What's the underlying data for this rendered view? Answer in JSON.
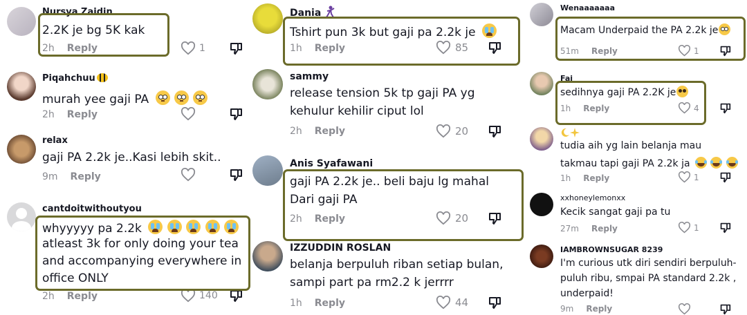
{
  "columns": [
    {
      "comments": [
        {
          "username": "Nursya Zaidin",
          "text": [
            "2.2K je bg 5K kak"
          ],
          "time": "2h",
          "reply": "Reply",
          "likes": "1",
          "highlighted": true
        },
        {
          "username": "Piqahchuu",
          "text": [
            "murah yee gaji PA"
          ],
          "time": "2h",
          "reply": "Reply",
          "likes": "",
          "highlighted": false
        },
        {
          "username": "relax",
          "text": [
            "gaji PA 2.2k je..Kasi lebih skit.."
          ],
          "time": "9m",
          "reply": "Reply",
          "likes": "",
          "highlighted": false
        },
        {
          "username": "cantdoitwithoutyou",
          "text": [
            "whyyyyy pa 2.2k",
            "atleast 3k for only doing your tea",
            "and accompanying everywhere in",
            "office ONLY"
          ],
          "time": "2h",
          "reply": "Reply",
          "likes": "140",
          "highlighted": true
        }
      ]
    },
    {
      "comments": [
        {
          "username": "Dania",
          "text": [
            "Tshirt pun 3k but gaji pa 2.2k je"
          ],
          "time": "1h",
          "reply": "Reply",
          "likes": "85",
          "highlighted": true
        },
        {
          "username": "sammy",
          "text": [
            "release tension 5k tp gaji PA yg",
            "kehulur kehilir ciput lol"
          ],
          "time": "2h",
          "reply": "Reply",
          "likes": "20",
          "highlighted": false
        },
        {
          "username": "Anis Syafawani",
          "text": [
            "gaji PA 2.2k je.. beli baju lg mahal",
            "Dari gaji PA"
          ],
          "time": "2h",
          "reply": "Reply",
          "likes": "20",
          "highlighted": true
        },
        {
          "username": "IZZUDDIN ROSLAN",
          "text": [
            "belanja berpuluh riban setiap bulan,",
            "sampi part pa rm2.2 k jerrrr"
          ],
          "time": "1h",
          "reply": "Reply",
          "likes": "44",
          "highlighted": false
        }
      ]
    },
    {
      "comments": [
        {
          "username": "Wenaaaaaaa",
          "text": [
            "Macam Underpaid the PA 2.2k je"
          ],
          "time": "51m",
          "reply": "Reply",
          "likes": "1",
          "highlighted": true
        },
        {
          "username": "Fai",
          "text": [
            "sedihnya gaji PA 2.2K je"
          ],
          "time": "1h",
          "reply": "Reply",
          "likes": "4",
          "highlighted": true
        },
        {
          "username": "",
          "text": [
            "tudia aih yg lain belanja mau",
            "takmau tapi gaji PA 2.2k ja"
          ],
          "time": "1h",
          "reply": "Reply",
          "likes": "1",
          "highlighted": false
        },
        {
          "username": "xxhoneylemonxx",
          "text": [
            "Kecik sangat gaji pa tu"
          ],
          "time": "27m",
          "reply": "Reply",
          "likes": "1",
          "highlighted": false
        },
        {
          "username": "IAMBROWNSUGAR 8239",
          "text": [
            "I'm curious utk diri sendiri berpuluh-",
            "puluh ribu, smpai PA standard 2.2k ,",
            "underpaid!"
          ],
          "time": "9m",
          "reply": "Reply",
          "likes": "",
          "highlighted": false
        }
      ]
    }
  ],
  "colors": {
    "highlight_border": "#6b6b2a",
    "muted": "#8a8b91",
    "text": "#161823"
  },
  "icons": [
    "heart-outline-icon",
    "thumb-down-icon",
    "crying-emoji",
    "flushed-emoji",
    "pleading-emoji",
    "laughing-tears-emoji",
    "bee-emoji",
    "dancer-emoji",
    "sparkles-emoji",
    "moon-emoji"
  ]
}
